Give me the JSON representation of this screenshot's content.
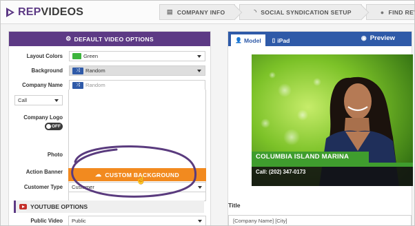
{
  "app": {
    "brand_prefix": "REP",
    "brand_suffix": "VIDEOS"
  },
  "steps": [
    {
      "icon": "list-icon",
      "label": "COMPANY INFO"
    },
    {
      "icon": "rss-icon",
      "label": "SOCIAL SYNDICATION SETUP"
    },
    {
      "icon": "comment-icon",
      "label": "FIND REVIEWS"
    }
  ],
  "left_panel": {
    "header": "DEFAULT VIDEO OPTIONS",
    "layout_colors_label": "Layout Colors",
    "layout_colors_value": "Green",
    "background_label": "Background",
    "background_value": "Random",
    "company_name_label": "Company Name",
    "company_name_option": "Random",
    "call_value": "Call",
    "company_logo_label": "Company Logo",
    "logo_toggle": "OFF",
    "photo_label": "Photo",
    "action_banner_label": "Action Banner",
    "custom_background_button": "CUSTOM BACKGROUND",
    "customer_type_label": "Customer Type",
    "customer_type_value": "Customer",
    "youtube_header": "YOUTUBE OPTIONS",
    "public_video_label": "Public Video",
    "public_video_value": "Public"
  },
  "right_panel": {
    "tab_model": "Model",
    "tab_ipad": "iPad",
    "preview_label": "Preview",
    "banner_title": "COLUMBIA ISLAND MARINA",
    "banner_phone": "Call: (202) 347-0173",
    "title_label": "Title",
    "title_value": "[Company Name] [City]"
  },
  "colors": {
    "brand_purple": "#5d3a85",
    "tab_blue": "#2f5aa8",
    "cta_orange": "#f28a1f",
    "green_swatch": "#3cb43c",
    "banner_green": "#3f9d2e"
  }
}
